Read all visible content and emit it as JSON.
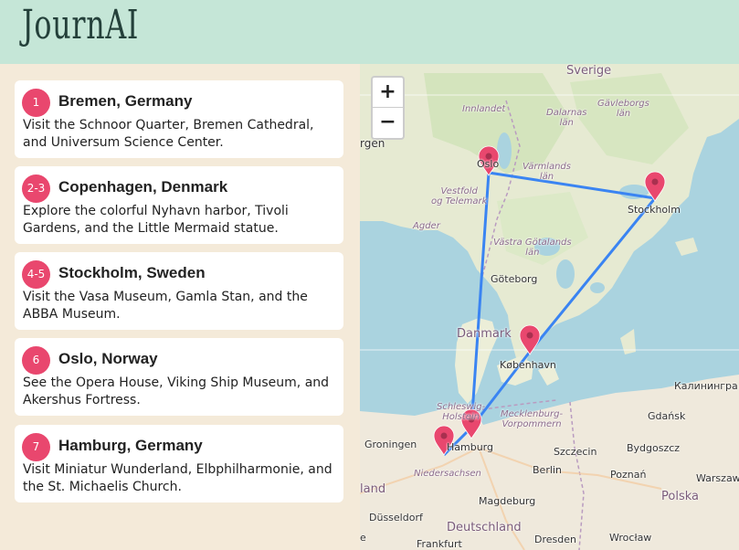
{
  "app": {
    "title": "JournAI"
  },
  "stops": [
    {
      "badge": "1",
      "title": "Bremen, Germany",
      "description": "Visit the Schnoor Quarter, Bremen Cathedral, and Universum Science Center."
    },
    {
      "badge": "2-3",
      "title": "Copenhagen, Denmark",
      "description": "Explore the colorful Nyhavn harbor, Tivoli Gardens, and the Little Mermaid statue."
    },
    {
      "badge": "4-5",
      "title": "Stockholm, Sweden",
      "description": "Visit the Vasa Museum, Gamla Stan, and the ABBA Museum."
    },
    {
      "badge": "6",
      "title": "Oslo, Norway",
      "description": "See the Opera House, Viking Ship Museum, and Akershus Fortress."
    },
    {
      "badge": "7",
      "title": "Hamburg, Germany",
      "description": "Visit Miniatur Wunderland, Elbphilharmonie, and the St. Michaelis Church."
    }
  ],
  "map": {
    "zoom_in": "+",
    "zoom_out": "−",
    "route_color": "#3a84f2",
    "marker_color": "#e9476e",
    "labels": {
      "sverige": "Sverige",
      "innlandet": "Innlandet",
      "dalarnas_lan": "Dalarnas\nlän",
      "gavleborgs_lan": "Gävleborgs\nlän",
      "rgen": "rgen",
      "oslo": "Oslo",
      "varmlands_lan": "Värmlands\nlän",
      "vestfold_telemark": "Vestfold\nog Telemark",
      "stockholm": "Stockholm",
      "agder": "Agder",
      "vastra_gotalands_lan": "Västra Götalands\nlän",
      "goteborg": "Göteborg",
      "danmark": "Danmark",
      "kobenhavn": "København",
      "kaliningrad": "Калинингра",
      "schleswig_holstein": "Schleswig-\nHolstein",
      "mecklenburg_vorpommern": "Mecklenburg-\nVorpommern",
      "gdansk": "Gdańsk",
      "groningen": "Groningen",
      "hamburg": "Hamburg",
      "szczecin": "Szczecin",
      "bydgoszcz": "Bydgoszcz",
      "niedersachsen": "Niedersachsen",
      "berlin": "Berlin",
      "poznan": "Poznań",
      "warszawa": "Warszaw",
      "land": "land",
      "magdeburg": "Magdeburg",
      "polska": "Polska",
      "dusseldorf": "Düsseldorf",
      "deutschland": "Deutschland",
      "e": "e",
      "frankfurt": "Frankfurt",
      "dresden": "Dresden",
      "wroclaw": "Wrocław"
    }
  }
}
